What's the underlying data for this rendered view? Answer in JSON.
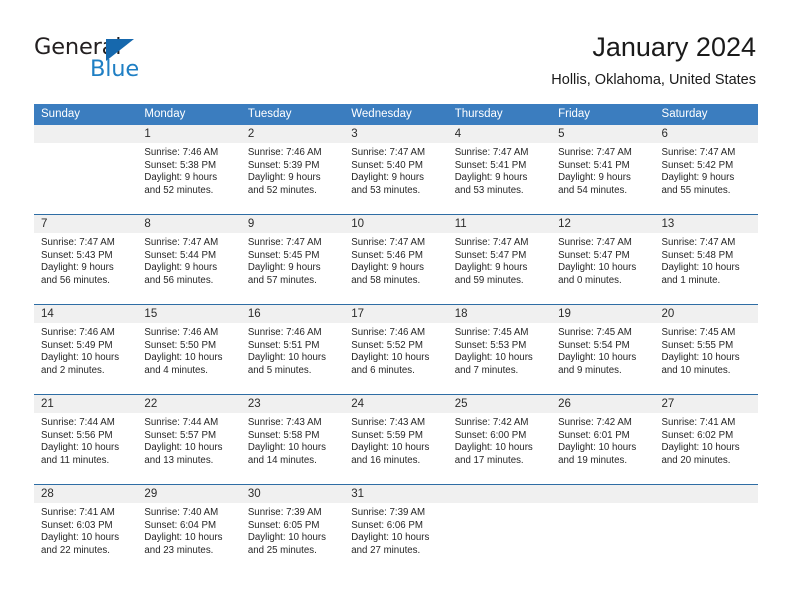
{
  "brand": {
    "name_part1": "General",
    "name_part2": "Blue",
    "logo_icon": "triangle-flag-icon",
    "accent_color": "#1f7fc4",
    "triangle_color": "#1668ad"
  },
  "header": {
    "title": "January 2024",
    "location": "Hollis, Oklahoma, United States"
  },
  "calendar": {
    "header_bg_color": "#3b7dbf",
    "daynum_bg_color": "#f0f0f0",
    "row_border_color": "#2e6da4",
    "weekdays": [
      "Sunday",
      "Monday",
      "Tuesday",
      "Wednesday",
      "Thursday",
      "Friday",
      "Saturday"
    ],
    "weeks": [
      [
        {
          "day": "",
          "sunrise": "",
          "sunset": "",
          "daylight": "",
          "daylight2": ""
        },
        {
          "day": "1",
          "sunrise": "Sunrise: 7:46 AM",
          "sunset": "Sunset: 5:38 PM",
          "daylight": "Daylight: 9 hours",
          "daylight2": "and 52 minutes."
        },
        {
          "day": "2",
          "sunrise": "Sunrise: 7:46 AM",
          "sunset": "Sunset: 5:39 PM",
          "daylight": "Daylight: 9 hours",
          "daylight2": "and 52 minutes."
        },
        {
          "day": "3",
          "sunrise": "Sunrise: 7:47 AM",
          "sunset": "Sunset: 5:40 PM",
          "daylight": "Daylight: 9 hours",
          "daylight2": "and 53 minutes."
        },
        {
          "day": "4",
          "sunrise": "Sunrise: 7:47 AM",
          "sunset": "Sunset: 5:41 PM",
          "daylight": "Daylight: 9 hours",
          "daylight2": "and 53 minutes."
        },
        {
          "day": "5",
          "sunrise": "Sunrise: 7:47 AM",
          "sunset": "Sunset: 5:41 PM",
          "daylight": "Daylight: 9 hours",
          "daylight2": "and 54 minutes."
        },
        {
          "day": "6",
          "sunrise": "Sunrise: 7:47 AM",
          "sunset": "Sunset: 5:42 PM",
          "daylight": "Daylight: 9 hours",
          "daylight2": "and 55 minutes."
        }
      ],
      [
        {
          "day": "7",
          "sunrise": "Sunrise: 7:47 AM",
          "sunset": "Sunset: 5:43 PM",
          "daylight": "Daylight: 9 hours",
          "daylight2": "and 56 minutes."
        },
        {
          "day": "8",
          "sunrise": "Sunrise: 7:47 AM",
          "sunset": "Sunset: 5:44 PM",
          "daylight": "Daylight: 9 hours",
          "daylight2": "and 56 minutes."
        },
        {
          "day": "9",
          "sunrise": "Sunrise: 7:47 AM",
          "sunset": "Sunset: 5:45 PM",
          "daylight": "Daylight: 9 hours",
          "daylight2": "and 57 minutes."
        },
        {
          "day": "10",
          "sunrise": "Sunrise: 7:47 AM",
          "sunset": "Sunset: 5:46 PM",
          "daylight": "Daylight: 9 hours",
          "daylight2": "and 58 minutes."
        },
        {
          "day": "11",
          "sunrise": "Sunrise: 7:47 AM",
          "sunset": "Sunset: 5:47 PM",
          "daylight": "Daylight: 9 hours",
          "daylight2": "and 59 minutes."
        },
        {
          "day": "12",
          "sunrise": "Sunrise: 7:47 AM",
          "sunset": "Sunset: 5:47 PM",
          "daylight": "Daylight: 10 hours",
          "daylight2": "and 0 minutes."
        },
        {
          "day": "13",
          "sunrise": "Sunrise: 7:47 AM",
          "sunset": "Sunset: 5:48 PM",
          "daylight": "Daylight: 10 hours",
          "daylight2": "and 1 minute."
        }
      ],
      [
        {
          "day": "14",
          "sunrise": "Sunrise: 7:46 AM",
          "sunset": "Sunset: 5:49 PM",
          "daylight": "Daylight: 10 hours",
          "daylight2": "and 2 minutes."
        },
        {
          "day": "15",
          "sunrise": "Sunrise: 7:46 AM",
          "sunset": "Sunset: 5:50 PM",
          "daylight": "Daylight: 10 hours",
          "daylight2": "and 4 minutes."
        },
        {
          "day": "16",
          "sunrise": "Sunrise: 7:46 AM",
          "sunset": "Sunset: 5:51 PM",
          "daylight": "Daylight: 10 hours",
          "daylight2": "and 5 minutes."
        },
        {
          "day": "17",
          "sunrise": "Sunrise: 7:46 AM",
          "sunset": "Sunset: 5:52 PM",
          "daylight": "Daylight: 10 hours",
          "daylight2": "and 6 minutes."
        },
        {
          "day": "18",
          "sunrise": "Sunrise: 7:45 AM",
          "sunset": "Sunset: 5:53 PM",
          "daylight": "Daylight: 10 hours",
          "daylight2": "and 7 minutes."
        },
        {
          "day": "19",
          "sunrise": "Sunrise: 7:45 AM",
          "sunset": "Sunset: 5:54 PM",
          "daylight": "Daylight: 10 hours",
          "daylight2": "and 9 minutes."
        },
        {
          "day": "20",
          "sunrise": "Sunrise: 7:45 AM",
          "sunset": "Sunset: 5:55 PM",
          "daylight": "Daylight: 10 hours",
          "daylight2": "and 10 minutes."
        }
      ],
      [
        {
          "day": "21",
          "sunrise": "Sunrise: 7:44 AM",
          "sunset": "Sunset: 5:56 PM",
          "daylight": "Daylight: 10 hours",
          "daylight2": "and 11 minutes."
        },
        {
          "day": "22",
          "sunrise": "Sunrise: 7:44 AM",
          "sunset": "Sunset: 5:57 PM",
          "daylight": "Daylight: 10 hours",
          "daylight2": "and 13 minutes."
        },
        {
          "day": "23",
          "sunrise": "Sunrise: 7:43 AM",
          "sunset": "Sunset: 5:58 PM",
          "daylight": "Daylight: 10 hours",
          "daylight2": "and 14 minutes."
        },
        {
          "day": "24",
          "sunrise": "Sunrise: 7:43 AM",
          "sunset": "Sunset: 5:59 PM",
          "daylight": "Daylight: 10 hours",
          "daylight2": "and 16 minutes."
        },
        {
          "day": "25",
          "sunrise": "Sunrise: 7:42 AM",
          "sunset": "Sunset: 6:00 PM",
          "daylight": "Daylight: 10 hours",
          "daylight2": "and 17 minutes."
        },
        {
          "day": "26",
          "sunrise": "Sunrise: 7:42 AM",
          "sunset": "Sunset: 6:01 PM",
          "daylight": "Daylight: 10 hours",
          "daylight2": "and 19 minutes."
        },
        {
          "day": "27",
          "sunrise": "Sunrise: 7:41 AM",
          "sunset": "Sunset: 6:02 PM",
          "daylight": "Daylight: 10 hours",
          "daylight2": "and 20 minutes."
        }
      ],
      [
        {
          "day": "28",
          "sunrise": "Sunrise: 7:41 AM",
          "sunset": "Sunset: 6:03 PM",
          "daylight": "Daylight: 10 hours",
          "daylight2": "and 22 minutes."
        },
        {
          "day": "29",
          "sunrise": "Sunrise: 7:40 AM",
          "sunset": "Sunset: 6:04 PM",
          "daylight": "Daylight: 10 hours",
          "daylight2": "and 23 minutes."
        },
        {
          "day": "30",
          "sunrise": "Sunrise: 7:39 AM",
          "sunset": "Sunset: 6:05 PM",
          "daylight": "Daylight: 10 hours",
          "daylight2": "and 25 minutes."
        },
        {
          "day": "31",
          "sunrise": "Sunrise: 7:39 AM",
          "sunset": "Sunset: 6:06 PM",
          "daylight": "Daylight: 10 hours",
          "daylight2": "and 27 minutes."
        },
        {
          "day": "",
          "sunrise": "",
          "sunset": "",
          "daylight": "",
          "daylight2": ""
        },
        {
          "day": "",
          "sunrise": "",
          "sunset": "",
          "daylight": "",
          "daylight2": ""
        },
        {
          "day": "",
          "sunrise": "",
          "sunset": "",
          "daylight": "",
          "daylight2": ""
        }
      ]
    ]
  }
}
